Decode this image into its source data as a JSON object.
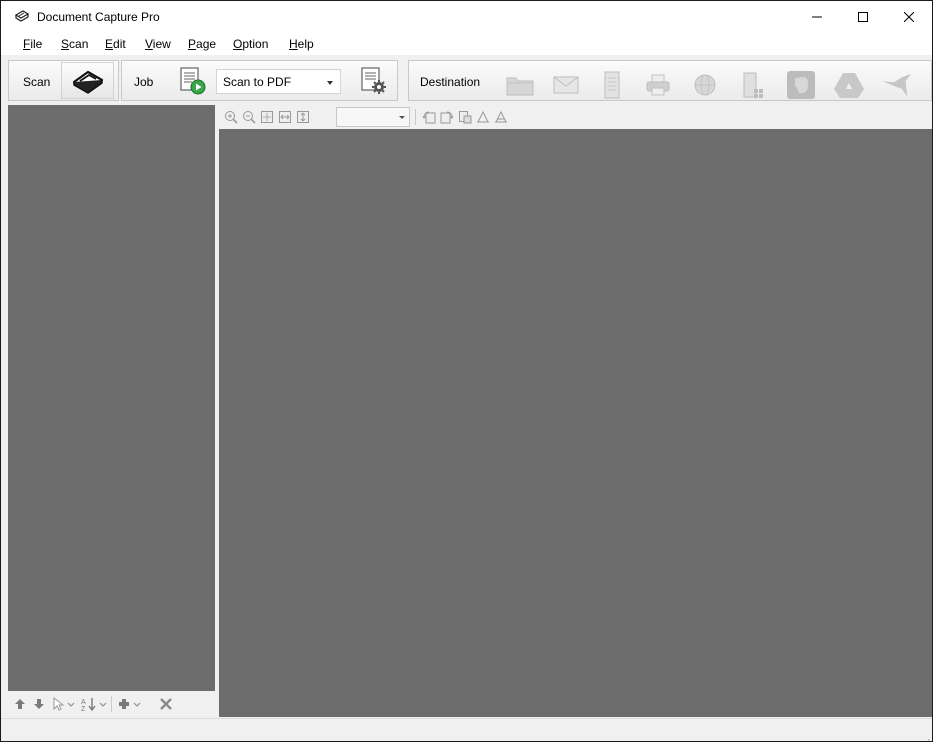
{
  "window": {
    "title": "Document Capture Pro",
    "controls": [
      "minimize",
      "maximize",
      "close"
    ]
  },
  "menu": [
    {
      "key": "F",
      "rest": "ile"
    },
    {
      "key": "S",
      "rest": "can"
    },
    {
      "key": "E",
      "rest": "dit"
    },
    {
      "key": "V",
      "rest": "iew"
    },
    {
      "key": "P",
      "rest": "age"
    },
    {
      "key": "O",
      "rest": "ption"
    },
    {
      "key": "H",
      "rest": "elp"
    }
  ],
  "toolbar": {
    "scan_label": "Scan",
    "job_label": "Job",
    "job_selected": "Scan to PDF",
    "destination_label": "Destination",
    "destinations": [
      "folder-icon",
      "email-icon",
      "document-server-icon",
      "printer-icon",
      "web-icon",
      "sharepoint-icon",
      "evernote-icon",
      "google-drive-icon",
      "hummingbird-icon"
    ]
  },
  "view_toolbar": {
    "zoom_value": "",
    "icons": [
      "zoom-in-icon",
      "zoom-out-icon",
      "fit-page-icon",
      "fit-width-icon",
      "actual-size-icon",
      "rotate-left-icon",
      "rotate-right-icon",
      "crop-icon",
      "skew-icon",
      "auto-rotate-icon"
    ]
  },
  "left_panel": {
    "icons": [
      "move-up-icon",
      "move-down-icon",
      "select-icon",
      "sort-icon",
      "add-icon",
      "delete-icon"
    ]
  },
  "colors": {
    "panel_bg": "#6c6c6c",
    "chrome_bg": "#f0f0f0",
    "accent_green": "#3aa64a"
  }
}
